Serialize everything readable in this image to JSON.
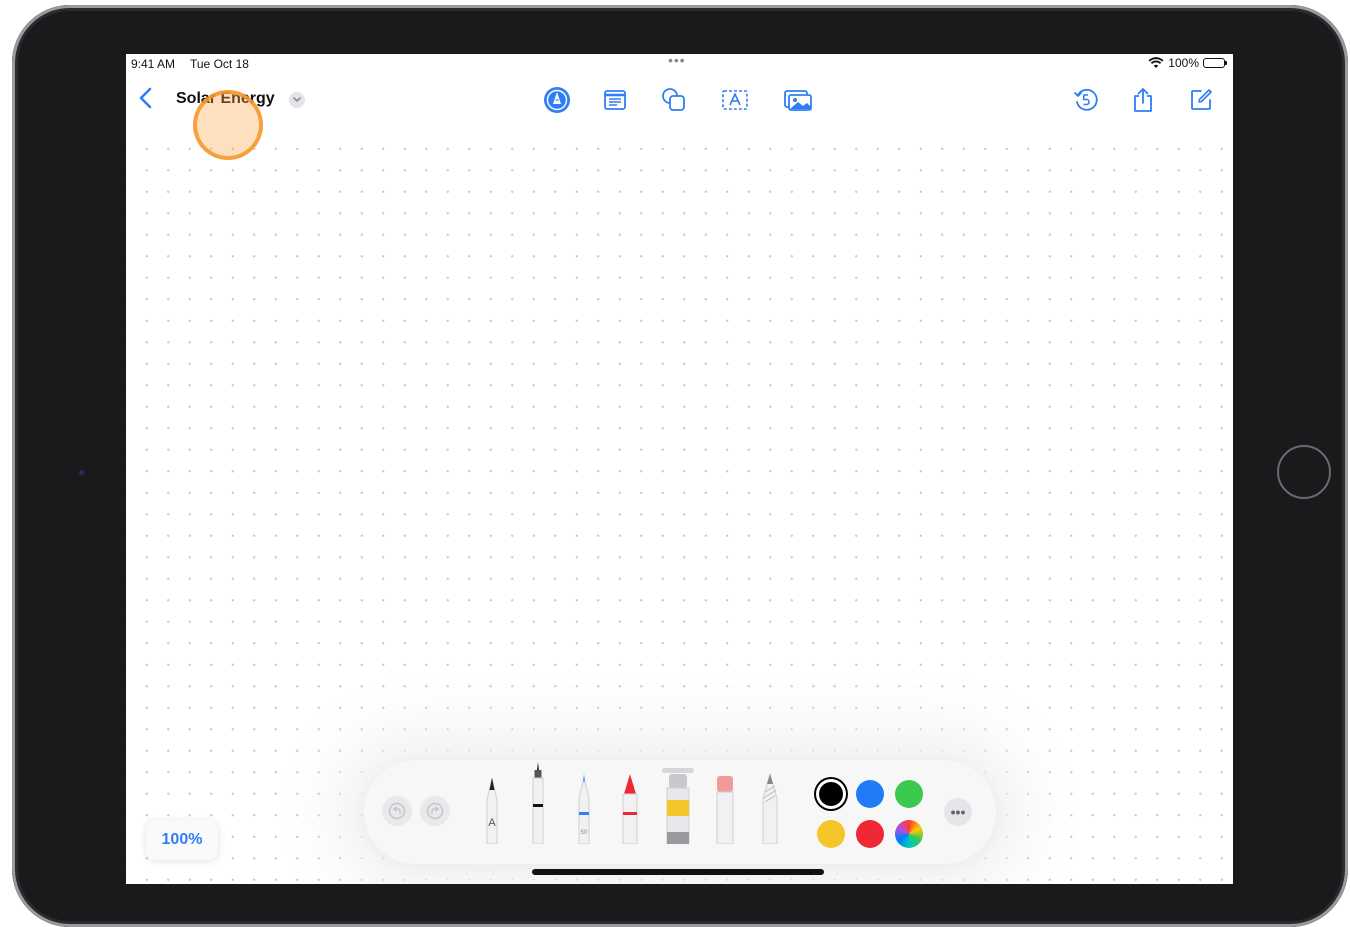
{
  "status_bar": {
    "time": "9:41 AM",
    "date": "Tue Oct 18",
    "battery": "100%",
    "multitask_dots": "•••"
  },
  "navbar": {
    "title": "Solar Energy",
    "left_icons": [
      "back-chevron-icon",
      "chevron-down-icon"
    ],
    "center_icons": [
      "pencil-markup-icon",
      "sticky-note-icon",
      "shapes-icon",
      "text-box-icon",
      "photo-library-icon"
    ],
    "right_icons": [
      "version-history-icon",
      "share-icon",
      "compose-icon"
    ]
  },
  "canvas": {
    "background": "dot-grid"
  },
  "palette": {
    "tools": [
      "monoline-pen",
      "fountain-pen",
      "fineliner",
      "marker",
      "watercolor-brush",
      "eraser",
      "pencil"
    ],
    "colors": [
      "#000000",
      "#1f7cf5",
      "#3bc84f",
      "#f6c52a",
      "#ee2935",
      "rainbow"
    ],
    "selected_color": "#000000",
    "more_label": "•••"
  },
  "zoom": {
    "label": "100%"
  },
  "colors": {
    "accent": "#2f7ef5",
    "tap_highlight": "#f59628"
  }
}
